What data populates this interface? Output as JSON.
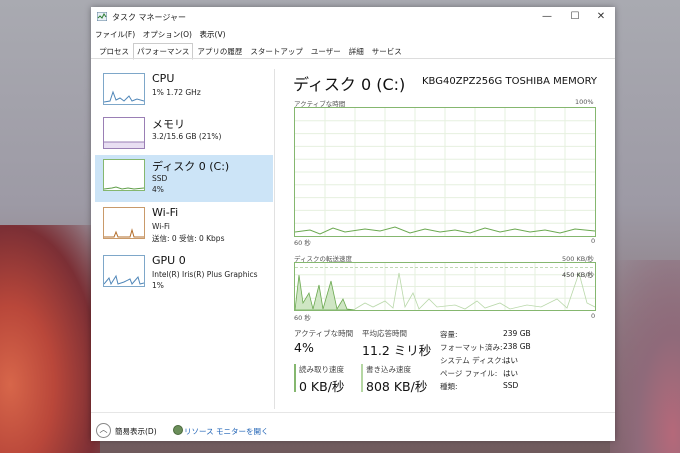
{
  "window": {
    "title": "タスク マネージャー",
    "controls": {
      "minimize": "—",
      "maximize": "☐",
      "close": "✕"
    }
  },
  "menu": [
    "ファイル(F)",
    "オプション(O)",
    "表示(V)"
  ],
  "tabs": [
    {
      "label": "プロセス",
      "active": false
    },
    {
      "label": "パフォーマンス",
      "active": true
    },
    {
      "label": "アプリの履歴",
      "active": false
    },
    {
      "label": "スタートアップ",
      "active": false
    },
    {
      "label": "ユーザー",
      "active": false
    },
    {
      "label": "詳細",
      "active": false
    },
    {
      "label": "サービス",
      "active": false
    }
  ],
  "sidebar": {
    "items": [
      {
        "name": "CPU",
        "line1": "1%  1.72 GHz",
        "line2": ""
      },
      {
        "name": "メモリ",
        "line1": "3.2/15.6 GB (21%)",
        "line2": ""
      },
      {
        "name": "ディスク 0 (C:)",
        "line1": "SSD",
        "line2": "4%"
      },
      {
        "name": "Wi-Fi",
        "line1": "Wi-Fi",
        "line2": "送信: 0 受信: 0 Kbps"
      },
      {
        "name": "GPU 0",
        "line1": "Intel(R) Iris(R) Plus Graphics",
        "line2": "1%"
      }
    ]
  },
  "main": {
    "title": "ディスク 0 (C:)",
    "model": "KBG40ZPZ256G TOSHIBA MEMORY",
    "graph1": {
      "label": "アクティブな時間",
      "max": "100%",
      "time": "60 秒",
      "end": "0"
    },
    "graph2": {
      "label": "ディスクの転送速度",
      "max": "500 KB/秒",
      "marker": "450 KB/秒",
      "time": "60 秒",
      "end": "0"
    },
    "stats": {
      "active_label": "アクティブな時間",
      "active_value": "4%",
      "resp_label": "平均応答時間",
      "resp_value": "11.2 ミリ秒",
      "read_label": "読み取り速度",
      "read_value": "0 KB/秒",
      "write_label": "書き込み速度",
      "write_value": "808 KB/秒"
    },
    "properties": [
      {
        "k": "容量:",
        "v": "239 GB"
      },
      {
        "k": "フォーマット済み:",
        "v": "238 GB"
      },
      {
        "k": "システム ディスク:",
        "v": "はい"
      },
      {
        "k": "ページ ファイル:",
        "v": "はい"
      },
      {
        "k": "種類:",
        "v": "SSD"
      }
    ]
  },
  "footer": {
    "fewer": "簡易表示(D)",
    "resmon": "リソース モニターを開く"
  },
  "colors": {
    "disk_green": "#85b76f",
    "cpu_blue": "#7ea7c9",
    "selected_bg": "#cce4f7",
    "link": "#1a5fb4"
  }
}
